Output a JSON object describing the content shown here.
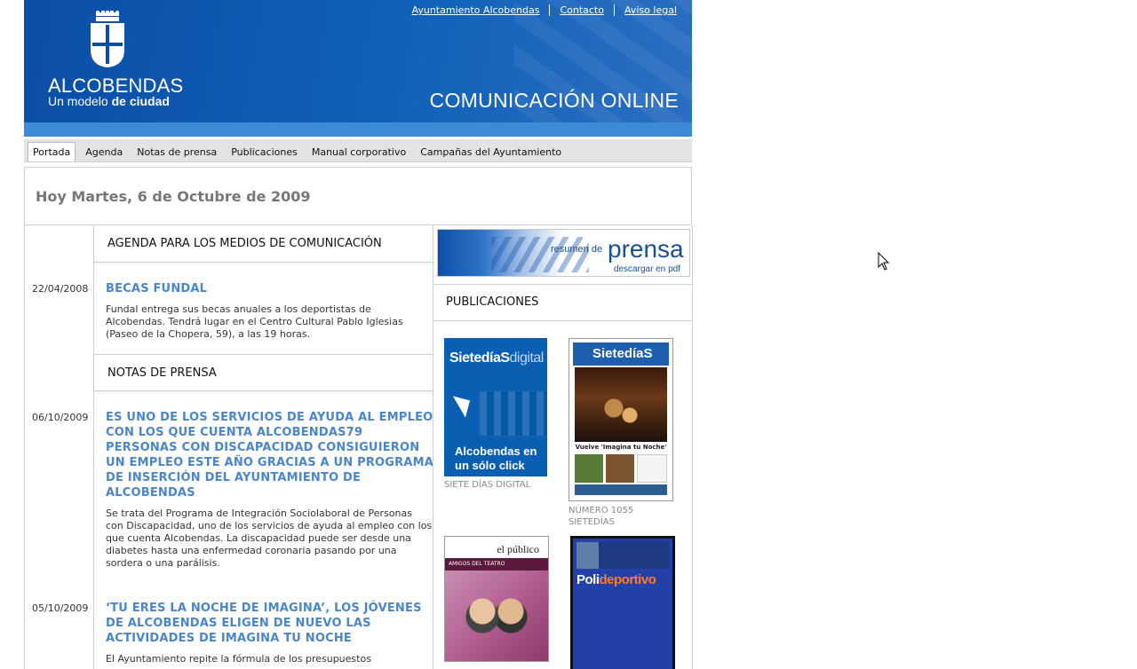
{
  "header": {
    "logo_name": "ALCOBENDAS",
    "logo_tag_a": "Un modelo ",
    "logo_tag_b": "de ciudad",
    "site_title": "COMUNICACIÓN ONLINE",
    "top_links": [
      "Ayuntamiento Alcobendas",
      "Contacto",
      "Aviso legal"
    ]
  },
  "nav": {
    "tabs": [
      "Portada",
      "Agenda",
      "Notas de prensa",
      "Publicaciones",
      "Manual corporativo",
      "Campañas del Ayuntamiento"
    ],
    "active": "Portada"
  },
  "date_line": "Hoy Martes, 6 de Octubre de 2009",
  "agenda": {
    "heading": "AGENDA PARA LOS MEDIOS DE COMUNICACIÓN",
    "items": [
      {
        "date": "22/04/2008",
        "title": "BECAS FUNDAL",
        "body": "Fundal entrega sus becas anuales a los deportistas de Alcobendas. Tendrá lugar en el Centro Cultural Pablo Iglesias (Paseo de la Chopera, 59), a las 19 horas."
      }
    ]
  },
  "notas": {
    "heading": "NOTAS DE PRENSA",
    "items": [
      {
        "date": "06/10/2009",
        "title": "ES UNO DE LOS SERVICIOS DE AYUDA AL EMPLEO CON LOS QUE CUENTA ALCOBENDAS79 PERSONAS CON DISCAPACIDAD CONSIGUIERON UN EMPLEO ESTE AÑO GRACIAS A UN PROGRAMA DE INSERCIÓN DEL AYUNTAMIENTO DE ALCOBENDAS",
        "body": "Se trata del Programa de Integración Sociolaboral de Personas con Discapacidad, uno de los servicios de ayuda al empleo con los que cuenta Alcobendas. La discapacidad puede ser desde una diabetes hasta una enfermedad coronaria pasando por una sordera o una parálisis."
      },
      {
        "date": "05/10/2009",
        "title": "‘TU ERES LA NOCHE DE IMAGINA’, LOS JÓVENES DE ALCOBENDAS ELIGEN DE NUEVO LAS ACTIVIDADES DE IMAGINA TU NOCHE",
        "body": "El Ayuntamiento repite la fórmula de los presupuestos"
      }
    ]
  },
  "banner": {
    "small": "resumen de",
    "big": "prensa",
    "sub": "descargar en pdf"
  },
  "publicaciones": {
    "heading": "PUBLICACIONES",
    "items": [
      {
        "cover_title_a": "SietedíaS",
        "cover_title_b": "digital",
        "cover_line": "Alcobendas en un sólo click",
        "caption": "SIETE DÍAS DIGITAL"
      },
      {
        "cover_title": "SietedíaS",
        "cover_headline": "Vuelve 'Imagina tu Noche'",
        "caption_1": "NÚMERO 1055",
        "caption_2": "SIETEDÍAS"
      },
      {
        "cover_title": "el público",
        "cover_band": "AMIGOS DEL TEATRO"
      },
      {
        "cover_title_a": "Poli",
        "cover_title_b": "deportivo"
      }
    ]
  },
  "colors": {
    "header_blue": "#0b4ea6",
    "strip_blue": "#3d8ad6",
    "link_blue": "#4a86c8",
    "date_gray": "#777777"
  }
}
